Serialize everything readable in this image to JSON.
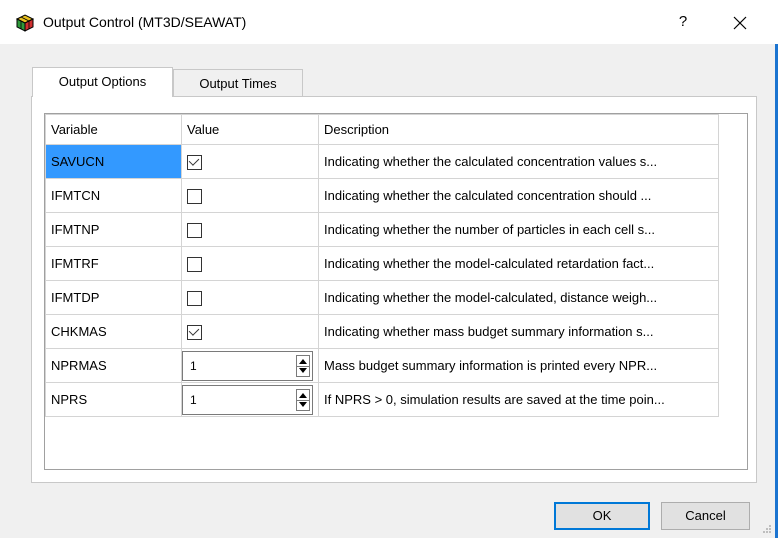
{
  "window": {
    "title": "Output Control (MT3D/SEAWAT)",
    "help_label": "?",
    "close_label": "✕",
    "icon": "grid-app-icon"
  },
  "tabs": [
    {
      "label": "Output Options",
      "active": true
    },
    {
      "label": "Output Times",
      "active": false
    }
  ],
  "grid": {
    "headers": [
      "Variable",
      "Value",
      "Description"
    ],
    "rows": [
      {
        "variable": "SAVUCN",
        "type": "checkbox",
        "checked": true,
        "description": "Indicating whether the calculated concentration values s..."
      },
      {
        "variable": "IFMTCN",
        "type": "checkbox",
        "checked": false,
        "description": "Indicating whether the calculated concentration should ..."
      },
      {
        "variable": "IFMTNP",
        "type": "checkbox",
        "checked": false,
        "description": "Indicating whether the number of particles in each cell s..."
      },
      {
        "variable": "IFMTRF",
        "type": "checkbox",
        "checked": false,
        "description": "Indicating whether the model-calculated retardation fact..."
      },
      {
        "variable": "IFMTDP",
        "type": "checkbox",
        "checked": false,
        "description": "Indicating whether the model-calculated, distance weigh..."
      },
      {
        "variable": "CHKMAS",
        "type": "checkbox",
        "checked": true,
        "description": "Indicating whether mass budget summary information s..."
      },
      {
        "variable": "NPRMAS",
        "type": "spinner",
        "value": "1",
        "description": "Mass budget summary information is printed every NPR..."
      },
      {
        "variable": "NPRS",
        "type": "spinner",
        "value": "1",
        "description": "If NPRS > 0, simulation results are saved at the time poin..."
      }
    ]
  },
  "buttons": {
    "ok": "OK",
    "cancel": "Cancel"
  },
  "colors": {
    "selection": "#3399ff",
    "focus_border": "#0078d7"
  }
}
